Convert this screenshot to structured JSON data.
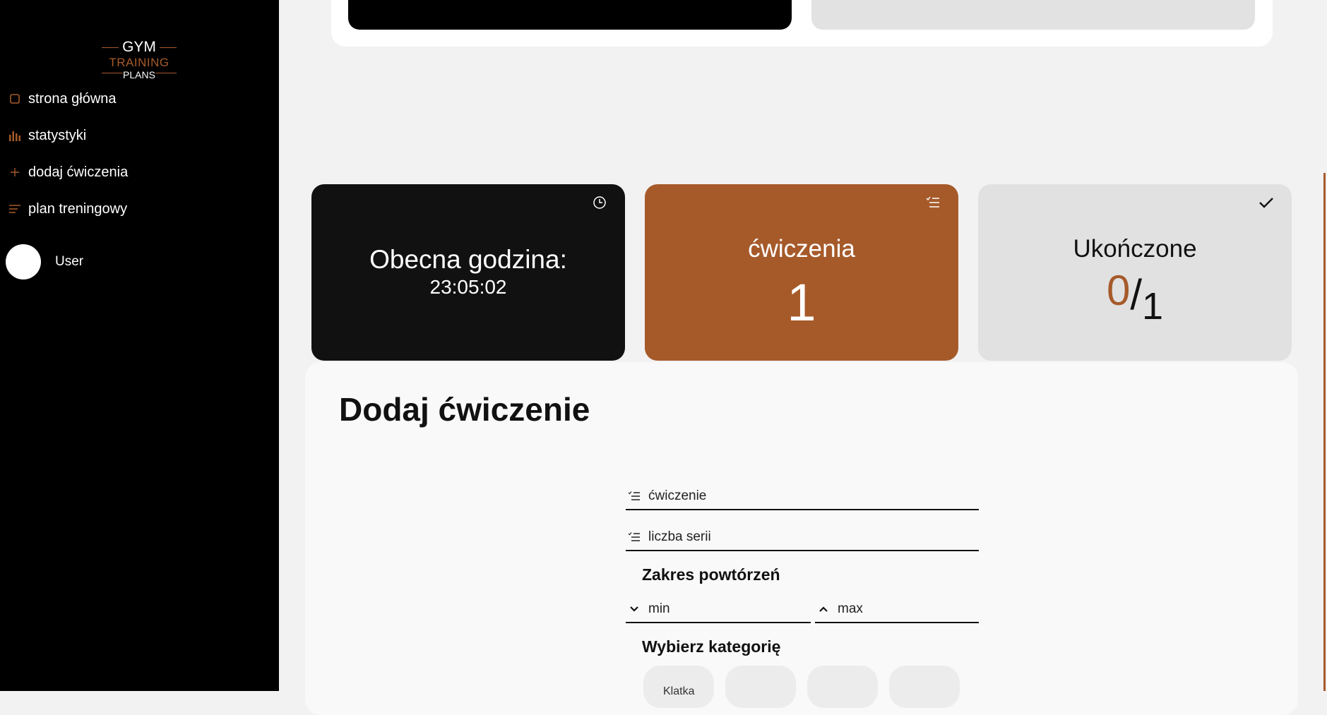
{
  "logo": {
    "line1": "GYM",
    "line2": "TRAINING",
    "line3": "PLANS"
  },
  "sidebar": {
    "items": [
      {
        "label": "strona główna",
        "icon": "square-icon"
      },
      {
        "label": "statystyki",
        "icon": "bar-chart-icon"
      },
      {
        "label": "dodaj ćwiczenia",
        "icon": "plus-icon"
      },
      {
        "label": "plan treningowy",
        "icon": "list-icon"
      }
    ],
    "user": {
      "name": "User"
    }
  },
  "cards": {
    "time": {
      "title": "Obecna godzina:",
      "value": "23:05:02",
      "icon": "clock-icon"
    },
    "exercises": {
      "title": "ćwiczenia",
      "value": "1",
      "icon": "checklist-icon"
    },
    "done": {
      "title": "Ukończone",
      "completed": "0",
      "total": "1",
      "icon": "check-icon"
    }
  },
  "form": {
    "title": "Dodaj ćwiczenie",
    "exercise_placeholder": "ćwiczenie",
    "sets_placeholder": "liczba serii",
    "reps_label": "Zakres powtórzeń",
    "min_placeholder": "min",
    "max_placeholder": "max",
    "category_label": "Wybierz kategorię",
    "categories": [
      "Klatka",
      "",
      "",
      ""
    ]
  },
  "colors": {
    "accent": "#a65a2a",
    "sidebar_bg": "#000000",
    "page_bg": "#f2f2f2"
  }
}
